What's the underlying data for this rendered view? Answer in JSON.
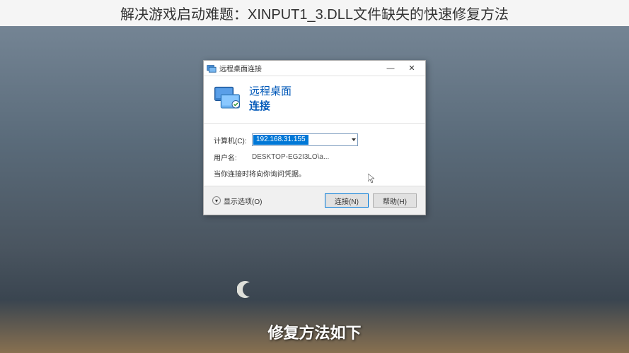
{
  "page": {
    "top_title": "解决游戏启动难题：XINPUT1_3.DLL文件缺失的快速修复方法",
    "caption": "修复方法如下"
  },
  "dialog": {
    "titlebar_text": "远程桌面连接",
    "header_title": "远程桌面",
    "header_subtitle": "连接",
    "computer_label": "计算机(C):",
    "computer_value": "192.168.31.155",
    "username_label": "用户名:",
    "username_value": "DESKTOP-EG2I3LO\\a...",
    "hint": "当你连接时将向你询问凭据。",
    "expand_label": "显示选项(O)",
    "connect_btn": "连接(N)",
    "help_btn": "帮助(H)"
  }
}
